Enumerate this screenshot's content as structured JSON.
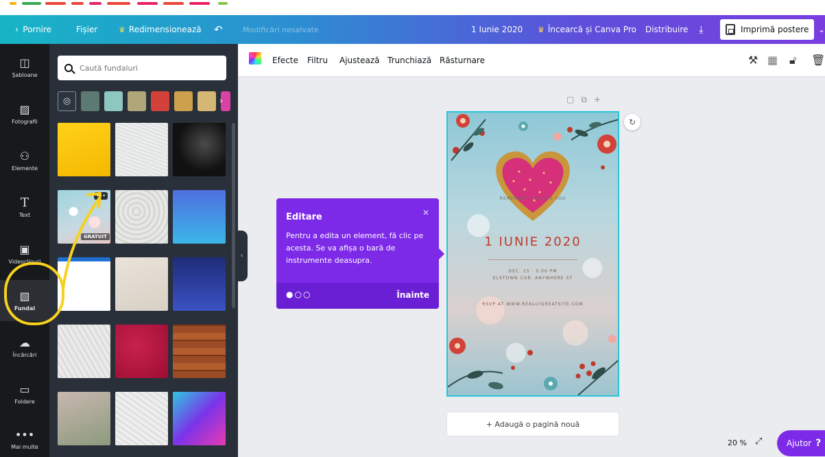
{
  "header": {
    "back_label": "Pornire",
    "file_label": "Fișier",
    "resize_label": "Redimensionează",
    "undo_icon": "undo-icon",
    "status": "Modificări nesalvate",
    "doc_title": "1 Iunie 2020",
    "try_pro_label": "Încearcă și Canva Pro",
    "share_label": "Distribuire",
    "print_label": "Imprimă postere"
  },
  "rail": {
    "items": [
      {
        "label": "Șabloane",
        "icon": "template-icon"
      },
      {
        "label": "Fotografii",
        "icon": "photo-icon"
      },
      {
        "label": "Elemente",
        "icon": "elements-icon"
      },
      {
        "label": "Text",
        "icon": "text-icon"
      },
      {
        "label": "Videoclipuri",
        "icon": "video-icon"
      },
      {
        "label": "Fundal",
        "icon": "background-icon"
      },
      {
        "label": "Încărcări",
        "icon": "upload-icon"
      },
      {
        "label": "Foldere",
        "icon": "folder-icon"
      },
      {
        "label": "Mai multe",
        "icon": "more-icon"
      }
    ]
  },
  "panel": {
    "search_placeholder": "Caută fundaluri",
    "swatches": [
      "#5d7a72",
      "#8dc7c0",
      "#b0a67a",
      "#d2423a",
      "#cca04c",
      "#d3b772"
    ],
    "free_badge": "GRATUIT",
    "more_dots": "•••"
  },
  "toolbar": {
    "effects": "Efecte",
    "filter": "Filtru",
    "adjust": "Ajustează",
    "crop": "Trunchiază",
    "flip": "Răsturnare"
  },
  "poster": {
    "title": "1 IUNIE 2020",
    "top_text": "REMEMBER TO LOVE YOU",
    "date_line": "DEC. 15 · 5:00 PM",
    "address_line": "ELSTOWN COR. ANYWHERE ST",
    "contact_line": "RSVP AT WWW.REALLYGREATSITE.COM"
  },
  "tooltip": {
    "title": "Editare",
    "body": "Pentru a edita un element, fă clic pe acesta. Se va afișa o bară de instrumente deasupra.",
    "next_label": "Înainte"
  },
  "canvas": {
    "add_page_label": "+ Adaugă o pagină nouă",
    "zoom_level": "20 %"
  },
  "help_label": "Ajutor"
}
